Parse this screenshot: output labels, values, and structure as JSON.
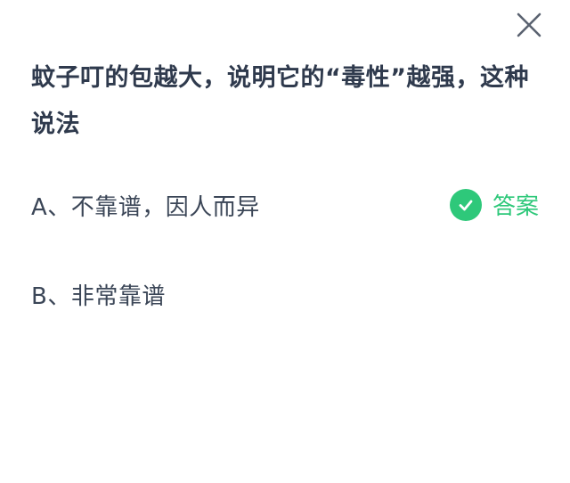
{
  "question": {
    "text": "蚊子叮的包越大，说明它的“毒性”越强，这种说法"
  },
  "options": [
    {
      "text": "A、不靠谱，因人而异",
      "is_answer": true
    },
    {
      "text": "B、非常靠谱",
      "is_answer": false
    }
  ],
  "answer_badge": {
    "label": "答案",
    "icon": "check-circle-icon",
    "color": "#2ec87a"
  },
  "close": {
    "icon": "close-icon"
  }
}
